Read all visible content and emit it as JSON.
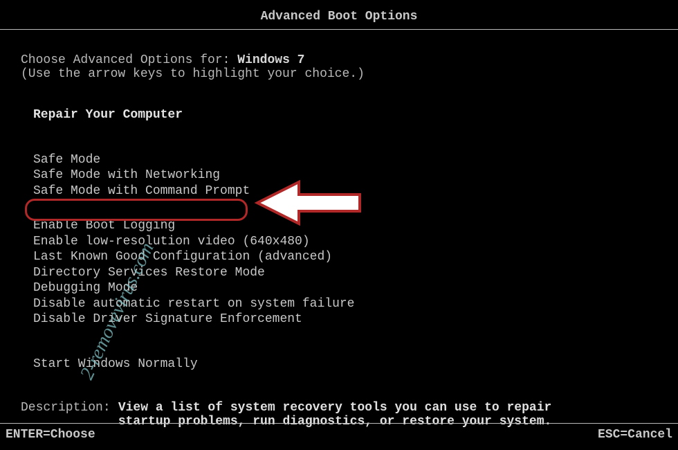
{
  "title": "Advanced Boot Options",
  "choose_prefix": "Choose Advanced Options for: ",
  "os_name": "Windows 7",
  "hint": "(Use the arrow keys to highlight your choice.)",
  "menu": {
    "repair": "Repair Your Computer",
    "safe": "Safe Mode",
    "safe_net": "Safe Mode with Networking",
    "safe_cmd": "Safe Mode with Command Prompt",
    "boot_log": "Enable Boot Logging",
    "low_res": "Enable low-resolution video (640x480)",
    "lkgc": "Last Known Good Configuration (advanced)",
    "dsrm": "Directory Services Restore Mode",
    "debug": "Debugging Mode",
    "no_restart": "Disable automatic restart on system failure",
    "no_sig": "Disable Driver Signature Enforcement",
    "start_normal": "Start Windows Normally"
  },
  "description": {
    "label": "Description:",
    "line1": "View a list of system recovery tools you can use to repair",
    "line2": "startup problems, run diagnostics, or restore your system."
  },
  "footer": {
    "enter": "ENTER=Choose",
    "esc": "ESC=Cancel"
  },
  "watermark": "2-removevirus.com"
}
